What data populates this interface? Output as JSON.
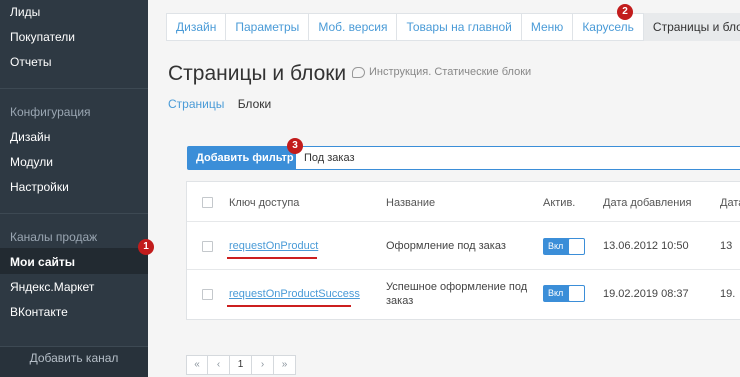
{
  "sidebar": {
    "items_top": [
      "Лиды",
      "Покупатели",
      "Отчеты"
    ],
    "section_config": "Конфигурация",
    "config_items": [
      "Дизайн",
      "Модули",
      "Настройки"
    ],
    "section_channels": "Каналы продаж",
    "channel_items": [
      "Мои сайты",
      "Яндекс.Маркет",
      "ВКонтакте"
    ],
    "add_channel": "Добавить канал"
  },
  "tabs": [
    "Дизайн",
    "Параметры",
    "Моб. версия",
    "Товары на главной",
    "Меню",
    "Карусель",
    "Страницы и блоки"
  ],
  "page": {
    "title": "Страницы и блоки",
    "help": "Инструкция. Статические блоки",
    "subnav": {
      "link": "Страницы",
      "current": "Блоки"
    }
  },
  "filter": {
    "button": "Добавить фильтр",
    "value": "Под заказ"
  },
  "table": {
    "headers": [
      "Ключ доступа",
      "Название",
      "Актив.",
      "Дата добавления",
      "Дата"
    ],
    "rows": [
      {
        "key": "requestOnProduct",
        "name": [
          "Оформление под заказ"
        ],
        "toggle": "Вкл",
        "date": "13.06.2012 10:50",
        "date2": "13"
      },
      {
        "key": "requestOnProductSuccess",
        "name": [
          "Успешное оформление под",
          "заказ"
        ],
        "toggle": "Вкл",
        "date": "19.02.2019 08:37",
        "date2": "19."
      }
    ]
  },
  "pagination": [
    "«",
    "‹",
    "1",
    "›",
    "»"
  ],
  "badges": [
    "1",
    "2",
    "3"
  ],
  "colors": {
    "sidebar": "#2e3943",
    "accent": "#3b8ed8",
    "badge": "#c21c1c"
  }
}
